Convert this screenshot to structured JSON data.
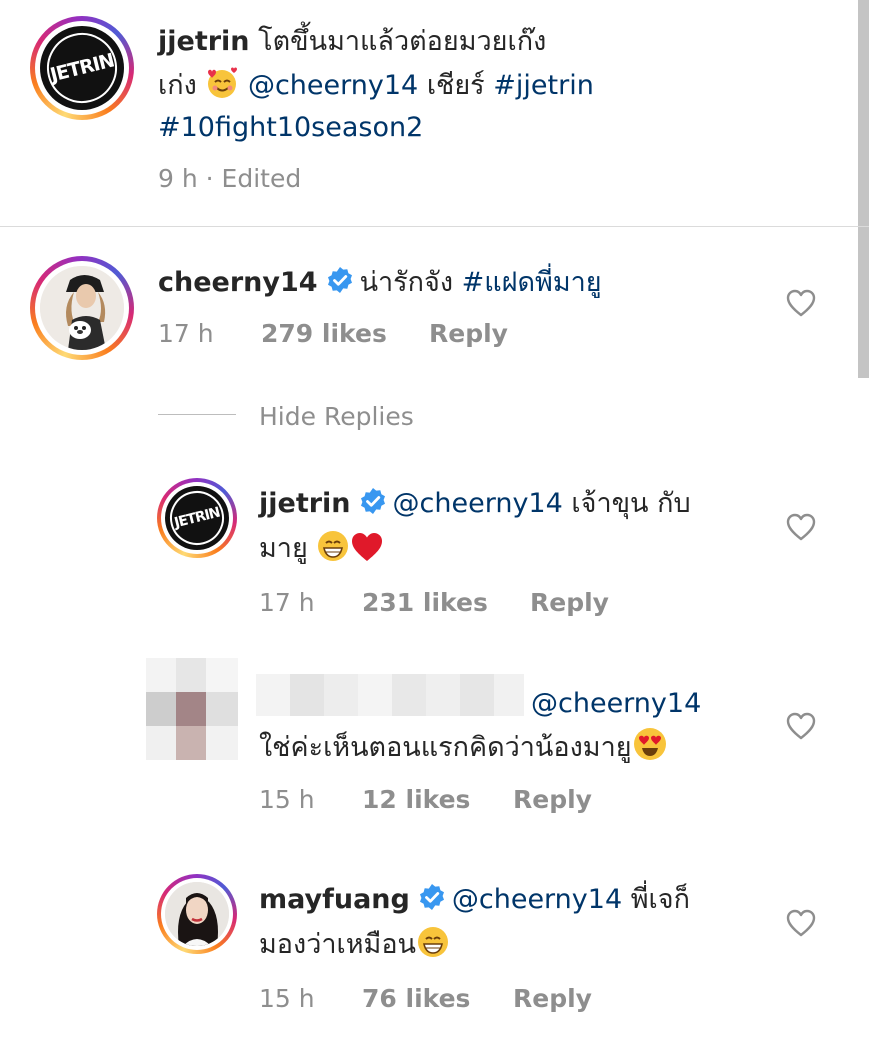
{
  "caption": {
    "username": "jjetrin",
    "line1": "โตขึ้นมาแล้วต่อยมวยเก๊ง",
    "line2_pre": "เก่ง",
    "mention": "@cheerny14",
    "line2_mid": "เชียร์",
    "hashtag1": "#jjetrin",
    "hashtag2": "#10fight10season2",
    "meta": "9 h · Edited",
    "avatar_text": "JETRIN"
  },
  "comments": [
    {
      "username": "cheerny14",
      "text": "น่ารักจัง",
      "hashtag": "#แฝดพี่มายู",
      "time": "17 h",
      "likes": "279 likes",
      "reply": "Reply",
      "hide_replies": "Hide Replies"
    }
  ],
  "replies": [
    {
      "username": "jjetrin",
      "mention": "@cheerny14",
      "text1": "เจ้าขุน กับ",
      "text2": "มายู",
      "time": "17 h",
      "likes": "231 likes",
      "reply": "Reply",
      "avatar_text": "JETRIN"
    },
    {
      "username": "",
      "mention": "@cheerny14",
      "text": "ใช่ค่ะเห็นตอนแรกคิดว่าน้องมายู",
      "time": "15 h",
      "likes": "12 likes",
      "reply": "Reply"
    },
    {
      "username": "mayfuang",
      "mention": "@cheerny14",
      "text1": "พี่เจก็",
      "text2": "มองว่าเหมือน",
      "time": "15 h",
      "likes": "76 likes",
      "reply": "Reply"
    }
  ],
  "colors": {
    "link": "#003569",
    "meta": "#8e8e8e",
    "verified": "#3897f0",
    "heart_stroke": "#8e8e8e",
    "emoji_heart": "#e0192a"
  }
}
